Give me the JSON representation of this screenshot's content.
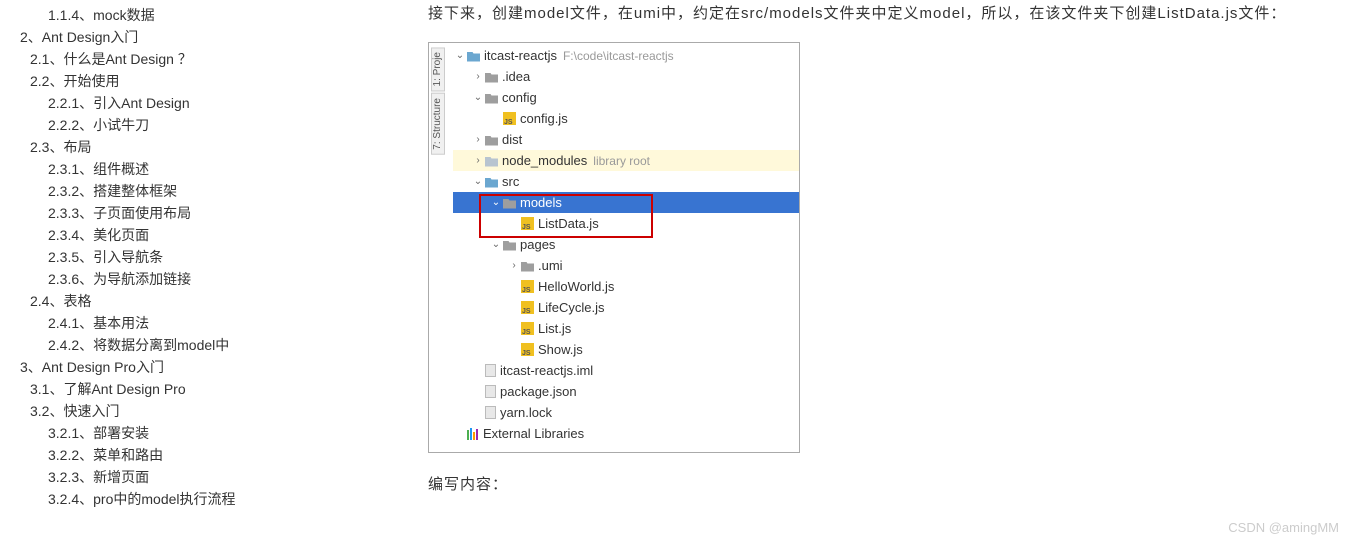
{
  "toc": [
    {
      "lvl": 3,
      "label": "1.1.4、mock数据"
    },
    {
      "lvl": 1,
      "label": "2、Ant Design入门"
    },
    {
      "lvl": 2,
      "label": "2.1、什么是Ant Design ？"
    },
    {
      "lvl": 2,
      "label": "2.2、开始使用"
    },
    {
      "lvl": 3,
      "label": "2.2.1、引入Ant Design"
    },
    {
      "lvl": 3,
      "label": "2.2.2、小试牛刀"
    },
    {
      "lvl": 2,
      "label": "2.3、布局"
    },
    {
      "lvl": 3,
      "label": "2.3.1、组件概述"
    },
    {
      "lvl": 3,
      "label": "2.3.2、搭建整体框架"
    },
    {
      "lvl": 3,
      "label": "2.3.3、子页面使用布局"
    },
    {
      "lvl": 3,
      "label": "2.3.4、美化页面"
    },
    {
      "lvl": 3,
      "label": "2.3.5、引入导航条"
    },
    {
      "lvl": 3,
      "label": "2.3.6、为导航添加链接"
    },
    {
      "lvl": 2,
      "label": "2.4、表格"
    },
    {
      "lvl": 3,
      "label": "2.4.1、基本用法"
    },
    {
      "lvl": 3,
      "label": "2.4.2、将数据分离到model中"
    },
    {
      "lvl": 1,
      "label": "3、Ant Design Pro入门"
    },
    {
      "lvl": 2,
      "label": "3.1、了解Ant Design Pro"
    },
    {
      "lvl": 2,
      "label": "3.2、快速入门"
    },
    {
      "lvl": 3,
      "label": "3.2.1、部署安装"
    },
    {
      "lvl": 3,
      "label": "3.2.2、菜单和路由"
    },
    {
      "lvl": 3,
      "label": "3.2.3、新增页面"
    },
    {
      "lvl": 3,
      "label": "3.2.4、pro中的model执行流程"
    }
  ],
  "main": {
    "para1": "接下来，创建model文件，在umi中，约定在src/models文件夹中定义model，所以，在该文件夹下创建ListData.js文件：",
    "para2": "编写内容："
  },
  "ide": {
    "vtab1": "1: Proje",
    "vtab2": "7: Structure",
    "tree": [
      {
        "depth": 0,
        "arrow": "v",
        "icon": "folder-blue",
        "name": "itcast-reactjs",
        "extra": "F:\\code\\itcast-reactjs"
      },
      {
        "depth": 1,
        "arrow": ">",
        "icon": "folder",
        "name": ".idea"
      },
      {
        "depth": 1,
        "arrow": "v",
        "icon": "folder",
        "name": "config"
      },
      {
        "depth": 2,
        "arrow": "",
        "icon": "js",
        "name": "config.js"
      },
      {
        "depth": 1,
        "arrow": ">",
        "icon": "folder",
        "name": "dist"
      },
      {
        "depth": 1,
        "arrow": ">",
        "icon": "folder-lt",
        "name": "node_modules",
        "extra": "library root",
        "hl": "yellow"
      },
      {
        "depth": 1,
        "arrow": "v",
        "icon": "folder-blue",
        "name": "src"
      },
      {
        "depth": 2,
        "arrow": "v",
        "icon": "folder",
        "name": "models",
        "hl": "blue"
      },
      {
        "depth": 3,
        "arrow": "",
        "icon": "js",
        "name": "ListData.js"
      },
      {
        "depth": 2,
        "arrow": "v",
        "icon": "folder",
        "name": "pages"
      },
      {
        "depth": 3,
        "arrow": ">",
        "icon": "folder",
        "name": ".umi"
      },
      {
        "depth": 3,
        "arrow": "",
        "icon": "js",
        "name": "HelloWorld.js"
      },
      {
        "depth": 3,
        "arrow": "",
        "icon": "js",
        "name": "LifeCycle.js"
      },
      {
        "depth": 3,
        "arrow": "",
        "icon": "js",
        "name": "List.js"
      },
      {
        "depth": 3,
        "arrow": "",
        "icon": "js",
        "name": "Show.js"
      },
      {
        "depth": 1,
        "arrow": "",
        "icon": "file",
        "name": "itcast-reactjs.iml"
      },
      {
        "depth": 1,
        "arrow": "",
        "icon": "file",
        "name": "package.json"
      },
      {
        "depth": 1,
        "arrow": "",
        "icon": "file",
        "name": "yarn.lock"
      },
      {
        "depth": 0,
        "arrow": "",
        "icon": "ext",
        "name": "External Libraries"
      }
    ]
  },
  "watermark": "CSDN @amingMM"
}
